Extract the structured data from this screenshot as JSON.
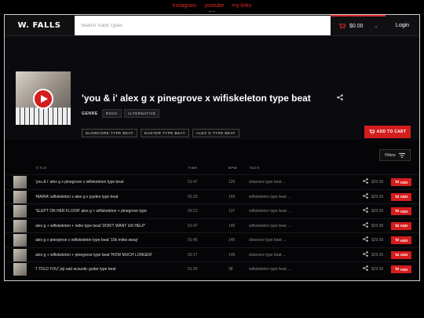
{
  "top_links": [
    "instagram",
    "youtube",
    "my links"
  ],
  "navbar": {
    "brand": "W. FALLS",
    "search_placeholder": "Search Track Types",
    "cart_total": "$0.00",
    "login_label": "Login"
  },
  "track": {
    "title": "'you & i' alex g x pinegrove x wifiskeleton type beat",
    "genre_label": "GENRE",
    "genres": [
      "ROCK",
      "ALTERNATIVE"
    ],
    "tags": [
      "SLOWCORE TYPE BEAT",
      "DUSTER TYPE BEAT",
      "ALEX G TYPE BEAT"
    ],
    "add_to_cart_label": "ADD TO CART"
  },
  "list": {
    "filters_label": "Filters",
    "columns": {
      "title": "TITLE",
      "time": "TIME",
      "bpm": "BPM",
      "tags": "TAGS"
    },
    "add_label": "ADD",
    "rows": [
      {
        "title": "'you & i' alex g x pinegrove x wifiskeleton type beat",
        "time": "01:47",
        "bpm": "129",
        "tags": "slowcore type beat ...",
        "price": "$29.95"
      },
      {
        "title": "'MARIA' wifiskeleton x alex g x joydes type beat",
        "time": "02:25",
        "bpm": "165",
        "tags": "wifiskeleton type beat ...",
        "price": "$29.95"
      },
      {
        "title": "'SLEPT ON HER FLOOR' alex g + wifiskeleton + pinegrove type",
        "time": "03:21",
        "bpm": "137",
        "tags": "wifiskeleton type beat ...",
        "price": "$29.95"
      },
      {
        "title": "alex g + wifiskeleton + indie type beat 'DON'T WANT UR HELP'",
        "time": "01:47",
        "bpm": "145",
        "tags": "wifiskeleton type beat ...",
        "price": "$29.95"
      },
      {
        "title": "alex g x pinegrove x wifiskeleton type beat '10k miles away'",
        "time": "01:45",
        "bpm": "145",
        "tags": "slowcore type beat ...",
        "price": "$29.95"
      },
      {
        "title": "alex g + wifiskeleton + pinegrove type beat 'HOW MUCH LONGER'",
        "time": "02:17",
        "bpm": "145",
        "tags": "slowcore type beat ...",
        "price": "$29.95"
      },
      {
        "title": "'I TOLD YOU' joji sad acoustic guitar type beat",
        "time": "01:25",
        "bpm": "98",
        "tags": "wifiskeleton type beat ...",
        "price": "$29.95"
      }
    ]
  },
  "colors": {
    "accent": "#d41d1d",
    "background": "#0b0b0f"
  }
}
